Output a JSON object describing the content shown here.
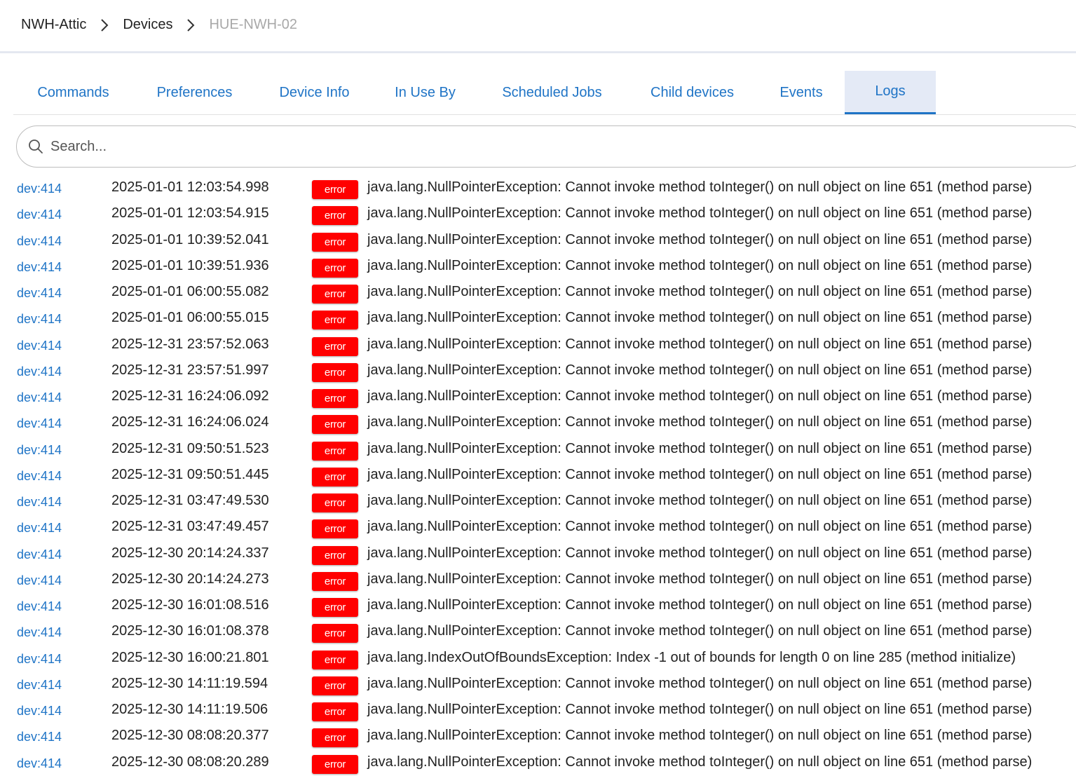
{
  "breadcrumb": {
    "items": [
      "NWH-Attic",
      "Devices"
    ],
    "current": "HUE-NWH-02"
  },
  "tabs": [
    {
      "label": "Commands",
      "active": false
    },
    {
      "label": "Preferences",
      "active": false
    },
    {
      "label": "Device Info",
      "active": false
    },
    {
      "label": "In Use By",
      "active": false
    },
    {
      "label": "Scheduled Jobs",
      "active": false
    },
    {
      "label": "Child devices",
      "active": false
    },
    {
      "label": "Events",
      "active": false
    },
    {
      "label": "Logs",
      "active": true
    }
  ],
  "search": {
    "placeholder": "Search...",
    "value": ""
  },
  "colors": {
    "link": "#1f74c6",
    "error_badge": "#ff0000",
    "active_tab_bg": "#e4eaf6"
  },
  "logs": [
    {
      "dev": "dev:414",
      "time": "2025-01-01 12:03:54.998",
      "level": "error",
      "message": "java.lang.NullPointerException: Cannot invoke method toInteger() on null object on line 651 (method parse)"
    },
    {
      "dev": "dev:414",
      "time": "2025-01-01 12:03:54.915",
      "level": "error",
      "message": "java.lang.NullPointerException: Cannot invoke method toInteger() on null object on line 651 (method parse)"
    },
    {
      "dev": "dev:414",
      "time": "2025-01-01 10:39:52.041",
      "level": "error",
      "message": "java.lang.NullPointerException: Cannot invoke method toInteger() on null object on line 651 (method parse)"
    },
    {
      "dev": "dev:414",
      "time": "2025-01-01 10:39:51.936",
      "level": "error",
      "message": "java.lang.NullPointerException: Cannot invoke method toInteger() on null object on line 651 (method parse)"
    },
    {
      "dev": "dev:414",
      "time": "2025-01-01 06:00:55.082",
      "level": "error",
      "message": "java.lang.NullPointerException: Cannot invoke method toInteger() on null object on line 651 (method parse)"
    },
    {
      "dev": "dev:414",
      "time": "2025-01-01 06:00:55.015",
      "level": "error",
      "message": "java.lang.NullPointerException: Cannot invoke method toInteger() on null object on line 651 (method parse)"
    },
    {
      "dev": "dev:414",
      "time": "2025-12-31 23:57:52.063",
      "level": "error",
      "message": "java.lang.NullPointerException: Cannot invoke method toInteger() on null object on line 651 (method parse)"
    },
    {
      "dev": "dev:414",
      "time": "2025-12-31 23:57:51.997",
      "level": "error",
      "message": "java.lang.NullPointerException: Cannot invoke method toInteger() on null object on line 651 (method parse)"
    },
    {
      "dev": "dev:414",
      "time": "2025-12-31 16:24:06.092",
      "level": "error",
      "message": "java.lang.NullPointerException: Cannot invoke method toInteger() on null object on line 651 (method parse)"
    },
    {
      "dev": "dev:414",
      "time": "2025-12-31 16:24:06.024",
      "level": "error",
      "message": "java.lang.NullPointerException: Cannot invoke method toInteger() on null object on line 651 (method parse)"
    },
    {
      "dev": "dev:414",
      "time": "2025-12-31 09:50:51.523",
      "level": "error",
      "message": "java.lang.NullPointerException: Cannot invoke method toInteger() on null object on line 651 (method parse)"
    },
    {
      "dev": "dev:414",
      "time": "2025-12-31 09:50:51.445",
      "level": "error",
      "message": "java.lang.NullPointerException: Cannot invoke method toInteger() on null object on line 651 (method parse)"
    },
    {
      "dev": "dev:414",
      "time": "2025-12-31 03:47:49.530",
      "level": "error",
      "message": "java.lang.NullPointerException: Cannot invoke method toInteger() on null object on line 651 (method parse)"
    },
    {
      "dev": "dev:414",
      "time": "2025-12-31 03:47:49.457",
      "level": "error",
      "message": "java.lang.NullPointerException: Cannot invoke method toInteger() on null object on line 651 (method parse)"
    },
    {
      "dev": "dev:414",
      "time": "2025-12-30 20:14:24.337",
      "level": "error",
      "message": "java.lang.NullPointerException: Cannot invoke method toInteger() on null object on line 651 (method parse)"
    },
    {
      "dev": "dev:414",
      "time": "2025-12-30 20:14:24.273",
      "level": "error",
      "message": "java.lang.NullPointerException: Cannot invoke method toInteger() on null object on line 651 (method parse)"
    },
    {
      "dev": "dev:414",
      "time": "2025-12-30 16:01:08.516",
      "level": "error",
      "message": "java.lang.NullPointerException: Cannot invoke method toInteger() on null object on line 651 (method parse)"
    },
    {
      "dev": "dev:414",
      "time": "2025-12-30 16:01:08.378",
      "level": "error",
      "message": "java.lang.NullPointerException: Cannot invoke method toInteger() on null object on line 651 (method parse)"
    },
    {
      "dev": "dev:414",
      "time": "2025-12-30 16:00:21.801",
      "level": "error",
      "message": "java.lang.IndexOutOfBoundsException: Index -1 out of bounds for length 0 on line 285 (method initialize)"
    },
    {
      "dev": "dev:414",
      "time": "2025-12-30 14:11:19.594",
      "level": "error",
      "message": "java.lang.NullPointerException: Cannot invoke method toInteger() on null object on line 651 (method parse)"
    },
    {
      "dev": "dev:414",
      "time": "2025-12-30 14:11:19.506",
      "level": "error",
      "message": "java.lang.NullPointerException: Cannot invoke method toInteger() on null object on line 651 (method parse)"
    },
    {
      "dev": "dev:414",
      "time": "2025-12-30 08:08:20.377",
      "level": "error",
      "message": "java.lang.NullPointerException: Cannot invoke method toInteger() on null object on line 651 (method parse)"
    },
    {
      "dev": "dev:414",
      "time": "2025-12-30 08:08:20.289",
      "level": "error",
      "message": "java.lang.NullPointerException: Cannot invoke method toInteger() on null object on line 651 (method parse)"
    }
  ]
}
